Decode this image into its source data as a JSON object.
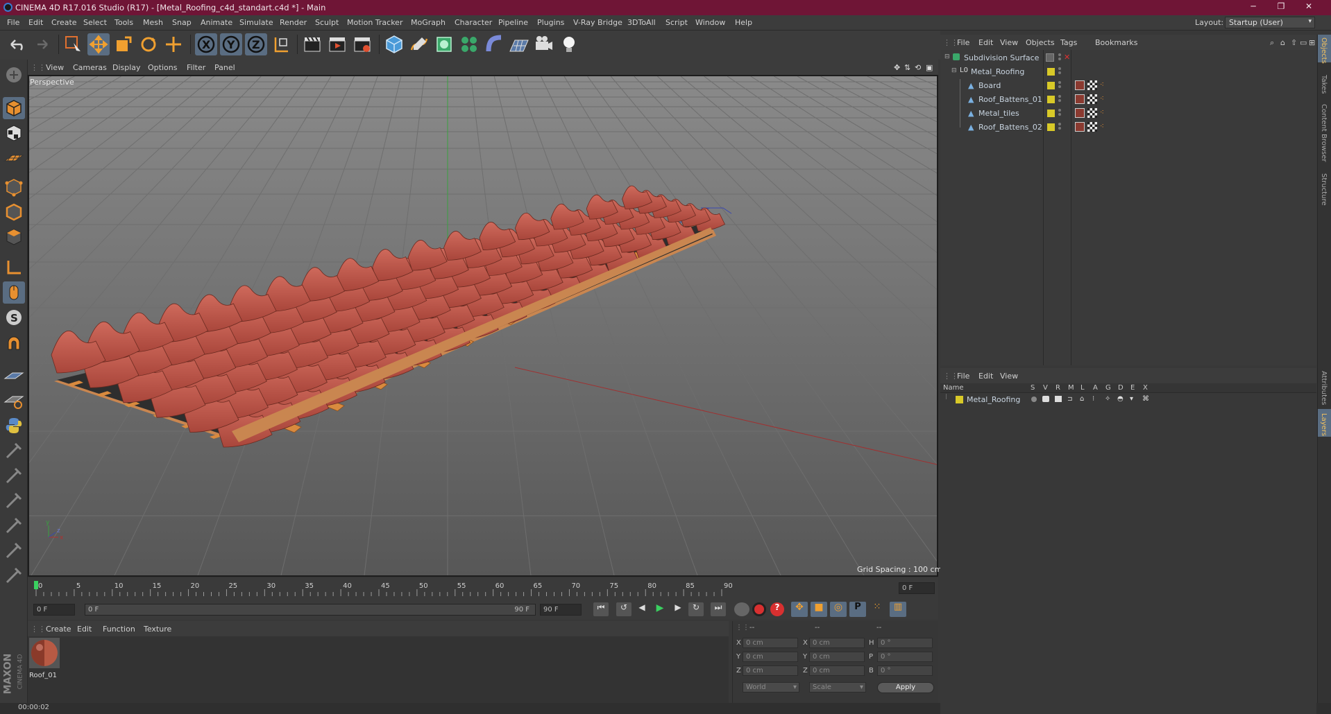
{
  "window": {
    "title": "CINEMA 4D R17.016 Studio (R17) - [Metal_Roofing_c4d_standart.c4d *] - Main",
    "minimize": "─",
    "restore": "❐",
    "close": "✕"
  },
  "menubar": {
    "items": [
      "File",
      "Edit",
      "Create",
      "Select",
      "Tools",
      "Mesh",
      "Snap",
      "Animate",
      "Simulate",
      "Render",
      "Sculpt",
      "Motion Tracker",
      "MoGraph",
      "Character",
      "Pipeline",
      "Plugins",
      "V-Ray Bridge",
      "3DToAll",
      "Script",
      "Window",
      "Help"
    ],
    "layout_label": "Layout:",
    "layout_value": "Startup (User)"
  },
  "viewport": {
    "menu": [
      "View",
      "Cameras",
      "Display",
      "Options",
      "Filter",
      "Panel"
    ],
    "camera_label": "Perspective",
    "grid_spacing": "Grid Spacing : 100 cm",
    "axis_x": "x",
    "axis_y": "y",
    "axis_z": "z"
  },
  "timeline": {
    "ticks": [
      "0",
      "5",
      "10",
      "15",
      "20",
      "25",
      "30",
      "35",
      "40",
      "45",
      "50",
      "55",
      "60",
      "65",
      "70",
      "75",
      "80",
      "85",
      "90"
    ],
    "current_frame_field": "0 F",
    "start_field": "0 F",
    "range_start": "0 F",
    "range_end": "90 F",
    "end_field": "90 F"
  },
  "material_manager": {
    "menu": [
      "Create",
      "Edit",
      "Function",
      "Texture"
    ],
    "materials": [
      {
        "name": "Roof_01"
      }
    ]
  },
  "coordinates": {
    "header": [
      "--",
      "--",
      "--"
    ],
    "rows": [
      {
        "a": "X",
        "av": "0 cm",
        "b": "X",
        "bv": "0 cm",
        "c": "H",
        "cv": "0 °"
      },
      {
        "a": "Y",
        "av": "0 cm",
        "b": "Y",
        "bv": "0 cm",
        "c": "P",
        "cv": "0 °"
      },
      {
        "a": "Z",
        "av": "0 cm",
        "b": "Z",
        "bv": "0 cm",
        "c": "B",
        "cv": "0 °"
      }
    ],
    "mode_world": "World",
    "mode_scale": "Scale",
    "apply": "Apply"
  },
  "status": {
    "time": "00:00:02"
  },
  "object_manager": {
    "menu": [
      "File",
      "Edit",
      "View",
      "Objects",
      "Tags",
      "Bookmarks"
    ],
    "objects": [
      {
        "name": "Subdivision Surface",
        "indent": 0
      },
      {
        "name": "Metal_Roofing",
        "indent": 1
      },
      {
        "name": "Board",
        "indent": 2
      },
      {
        "name": "Roof_Battens_01",
        "indent": 2
      },
      {
        "name": "Metal_tiles",
        "indent": 2
      },
      {
        "name": "Roof_Battens_02",
        "indent": 2
      }
    ]
  },
  "layer_manager": {
    "menu": [
      "File",
      "Edit",
      "View"
    ],
    "columns": [
      "Name",
      "S",
      "V",
      "R",
      "M",
      "L",
      "A",
      "G",
      "D",
      "E",
      "X"
    ],
    "layers": [
      {
        "name": "Metal_Roofing",
        "color": "#d8c928"
      }
    ]
  },
  "right_tabs": [
    "Objects",
    "Takes",
    "Content Browser",
    "Structure",
    "Attributes",
    "Layers"
  ],
  "branding": {
    "line1": "MAXON",
    "line2": "CINEMA 4D"
  },
  "colors": {
    "titlebar": "#6f1536",
    "tile": "#c0574a",
    "batten": "#d98a3e",
    "board": "#2e2e2e",
    "selection": "#5a6d82"
  },
  "icons": {
    "undo": "undo-icon",
    "redo": "redo-icon",
    "live_select": "live-select-icon",
    "move": "move-icon",
    "scale": "scale-icon",
    "rotate": "rotate-icon",
    "play": "play-icon",
    "record": "record-icon"
  }
}
